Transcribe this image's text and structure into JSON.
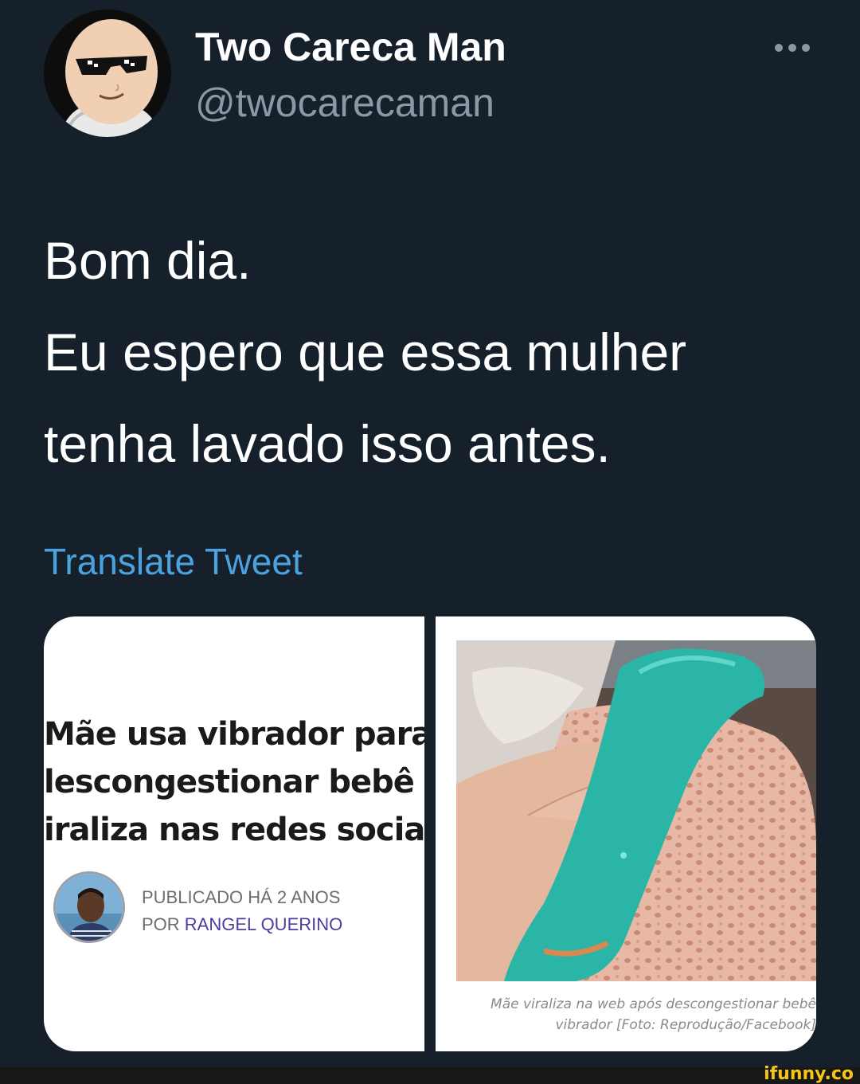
{
  "user": {
    "display_name": "Two Careca Man",
    "handle": "@twocarecaman",
    "avatar_icon": "bald-man-sunglasses-avatar"
  },
  "tweet": {
    "lines": [
      "Bom dia.",
      "Eu espero que essa mulher",
      "tenha lavado isso antes."
    ],
    "translate_label": "Translate Tweet"
  },
  "media": {
    "article": {
      "headline_lines": [
        "Mãe usa vibrador para",
        "lescongestionar bebê e",
        "iraliza nas redes sociais"
      ],
      "published": "PUBLICADO HÁ 2 ANOS",
      "by_prefix": "POR ",
      "author": "RANGEL QUERINO"
    },
    "photo": {
      "caption_lines": [
        "Mãe viraliza na web após descongestionar bebê",
        "vibrador [Foto: Reprodução/Facebook]"
      ]
    }
  },
  "watermark": "ifunny.co",
  "colors": {
    "background": "#15202b",
    "text_primary": "#ffffff",
    "text_secondary": "#8b98a5",
    "link": "#4aa3df",
    "watermark": "#f5c518"
  }
}
